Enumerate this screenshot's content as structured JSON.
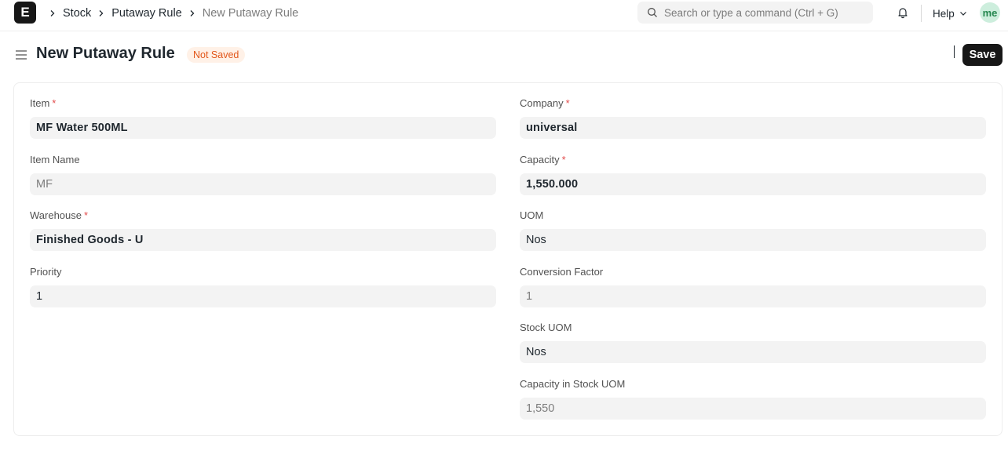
{
  "navbar": {
    "logo_letter": "E",
    "breadcrumbs": [
      "Stock",
      "Putaway Rule",
      "New Putaway Rule"
    ],
    "search_placeholder": "Search or type a command (Ctrl + G)",
    "help_label": "Help",
    "avatar_initials": "me"
  },
  "page": {
    "title": "New Putaway Rule",
    "status": "Not Saved",
    "save_label": "Save"
  },
  "form": {
    "left": [
      {
        "label": "Item",
        "required": "*",
        "value": "MF Water 500ML",
        "style": "bold"
      },
      {
        "label": "Item Name",
        "required": "",
        "value": "MF",
        "style": "readonly"
      },
      {
        "label": "Warehouse",
        "required": "*",
        "value": "Finished Goods - U",
        "style": "bold"
      },
      {
        "label": "Priority",
        "required": "",
        "value": "1",
        "style": "normal"
      }
    ],
    "right": [
      {
        "label": "Company",
        "required": "*",
        "value": "universal",
        "style": "bold"
      },
      {
        "label": "Capacity",
        "required": "*",
        "value": "1,550.000",
        "style": "bold"
      },
      {
        "label": "UOM",
        "required": "",
        "value": "Nos",
        "style": "normal"
      },
      {
        "label": "Conversion Factor",
        "required": "",
        "value": "1",
        "style": "readonly"
      },
      {
        "label": "Stock UOM",
        "required": "",
        "value": "Nos",
        "style": "normal"
      },
      {
        "label": "Capacity in Stock UOM",
        "required": "",
        "value": "1,550",
        "style": "readonly"
      }
    ]
  },
  "colors": {
    "accent_dark": "#171717",
    "status_text": "#e2571b",
    "status_bg": "#fff1e7",
    "required_marker": "#e24c4c",
    "field_bg": "#f3f3f3"
  }
}
